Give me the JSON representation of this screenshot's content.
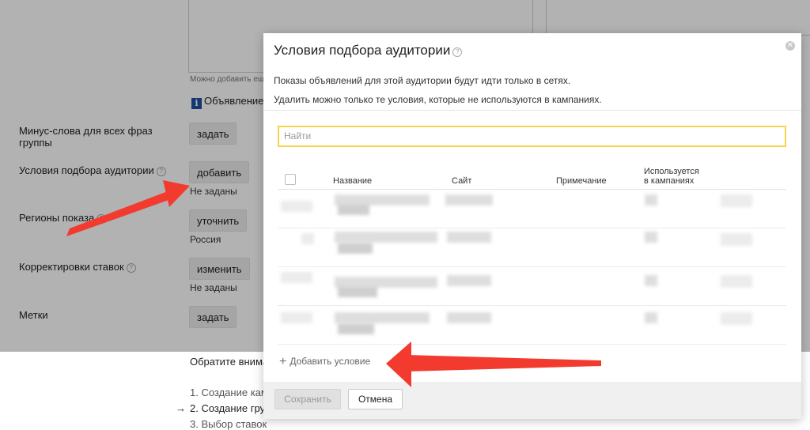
{
  "background": {
    "textarea_hint": "Можно добавить ещ",
    "notice": "Объявление",
    "rows": [
      {
        "label": "Минус-слова для всех фраз группы",
        "button": "задать",
        "sub": ""
      },
      {
        "label": "Условия подбора аудитории",
        "button": "добавить",
        "sub": "Не заданы"
      },
      {
        "label": "Регионы показа",
        "button": "уточнить",
        "sub": "Россия"
      },
      {
        "label": "Корректировки ставок",
        "button": "изменить",
        "sub": "Не заданы"
      },
      {
        "label": "Метки",
        "button": "задать",
        "sub": ""
      }
    ],
    "attention": "Обратите внима",
    "steps": [
      "1. Создание камп",
      "2. Создание груп",
      "3. Выбор ставок"
    ],
    "current_step_marker": "→"
  },
  "modal": {
    "title": "Условия подбора аудитории",
    "desc_line1": "Показы объявлений для этой аудитории будут идти только в сетях.",
    "desc_line2": "Удалить можно только те условия, которые не используются в кампаниях.",
    "search_placeholder": "Найти",
    "columns": {
      "name": "Название",
      "site": "Сайт",
      "note": "Примечание",
      "used_line1": "Используется",
      "used_line2": "в кампаниях"
    },
    "add_condition": "Добавить условие",
    "save_button": "Сохранить",
    "cancel_button": "Отмена"
  },
  "icons": {
    "info": "info-icon",
    "help": "question-circle-icon",
    "close": "close-circle-icon",
    "plus": "plus-icon"
  },
  "colors": {
    "search_border": "#f7d44a",
    "annotation_arrow": "#f23b2e",
    "info_icon": "#1f4fa0"
  }
}
